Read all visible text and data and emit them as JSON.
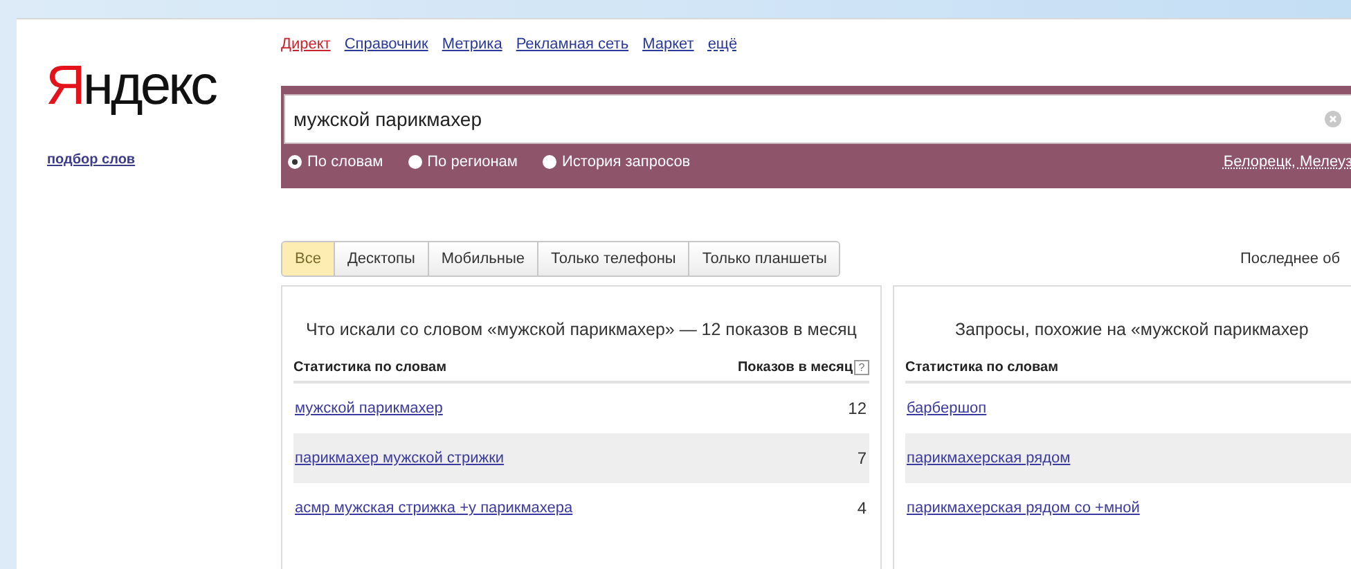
{
  "logo": {
    "initial": "Я",
    "rest": "ндекс"
  },
  "service_link": "подбор слов",
  "nav": [
    {
      "label": "Директ",
      "kind": "link",
      "selected": true
    },
    {
      "label": "Справочник",
      "kind": "link",
      "selected": false
    },
    {
      "label": "Метрика",
      "kind": "link",
      "selected": false
    },
    {
      "label": "Рекламная сеть",
      "kind": "link",
      "selected": false
    },
    {
      "label": "Маркет",
      "kind": "link",
      "selected": false
    },
    {
      "label": "ещё",
      "kind": "more",
      "selected": false
    }
  ],
  "search": {
    "value": "мужской парикмахер"
  },
  "modes": [
    {
      "label": "По словам",
      "selected": true
    },
    {
      "label": "По регионам",
      "selected": false
    },
    {
      "label": "История запросов",
      "selected": false
    }
  ],
  "region": "Белорецк, Мелеуз",
  "device_tabs": [
    {
      "label": "Все",
      "selected": true
    },
    {
      "label": "Десктопы",
      "selected": false
    },
    {
      "label": "Мобильные",
      "selected": false
    },
    {
      "label": "Только телефоны",
      "selected": false
    },
    {
      "label": "Только планшеты",
      "selected": false
    }
  ],
  "last_update": "Последнее об",
  "panels": [
    {
      "title": "Что искали со словом «мужской парикмахер» — 12 показов в месяц",
      "columns": [
        "Статистика по словам",
        "Показов в месяц"
      ],
      "help": "?",
      "rows": [
        {
          "phrase": "мужской парикмахер",
          "count": "12"
        },
        {
          "phrase": "парикмахер мужской стрижки",
          "count": "7"
        },
        {
          "phrase": "асмр мужская стрижка +у парикмахера",
          "count": "4"
        }
      ]
    },
    {
      "title": "Запросы, похожие на «мужской парикмахер",
      "columns": [
        "Статистика по словам"
      ],
      "rows": [
        {
          "phrase": "барбершоп"
        },
        {
          "phrase": "парикмахерская рядом"
        },
        {
          "phrase": "парикмахерская рядом со +мной"
        }
      ]
    }
  ]
}
